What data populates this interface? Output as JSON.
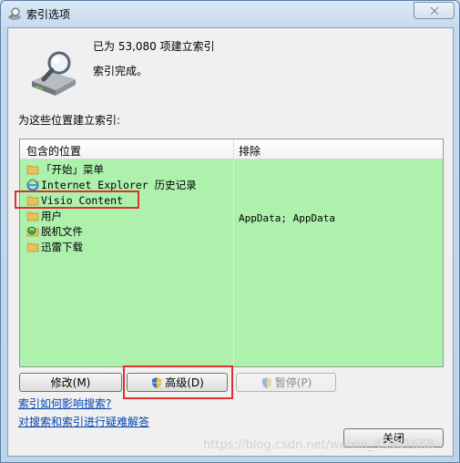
{
  "window": {
    "title": "索引选项"
  },
  "status": {
    "count_line": "已为 53,080 项建立索引",
    "complete_line": "索引完成。"
  },
  "section_label": "为这些位置建立索引:",
  "list": {
    "columns": [
      "包含的位置",
      "排除"
    ],
    "rows": [
      {
        "icon": "folder-icon",
        "label": "「开始」菜单"
      },
      {
        "icon": "ie-icon",
        "label": "Internet Explorer 历史记录"
      },
      {
        "icon": "folder-icon",
        "label": "Visio Content"
      },
      {
        "icon": "folder-icon",
        "label": "用户",
        "exclusions": "AppData; AppData"
      },
      {
        "icon": "sync-folder-icon",
        "label": "脱机文件"
      },
      {
        "icon": "folder-icon",
        "label": "迅雷下载"
      }
    ],
    "background_color": "#adf1ad"
  },
  "buttons": {
    "modify": "修改(M)",
    "advanced": "高级(D)",
    "pause": "暂停(P)",
    "close": "关闭"
  },
  "links": {
    "how_indexing": "索引如何影响搜索?",
    "troubleshoot": "对搜索和索引进行疑难解答"
  },
  "annotation_color": "#e0302a",
  "watermark": "https://blog.csdn.net/weixin_43951668"
}
